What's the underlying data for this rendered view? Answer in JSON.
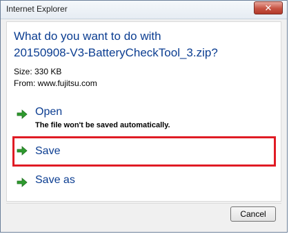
{
  "window": {
    "title": "Internet Explorer",
    "close_glyph": "✕"
  },
  "download": {
    "question_line1": "What do you want to do with",
    "question_line2": "20150908-V3-BatteryCheckTool_3.zip?",
    "size": "Size: 330 KB",
    "from": "From: www.fujitsu.com"
  },
  "options": {
    "open_label": "Open",
    "open_desc": "The file won't be saved automatically.",
    "save_label": "Save",
    "saveas_label": "Save as"
  },
  "footer": {
    "cancel_label": "Cancel"
  },
  "colors": {
    "link_blue": "#0b3d91",
    "arrow_green": "#2e9b2e",
    "highlight_red": "#e01b24"
  }
}
